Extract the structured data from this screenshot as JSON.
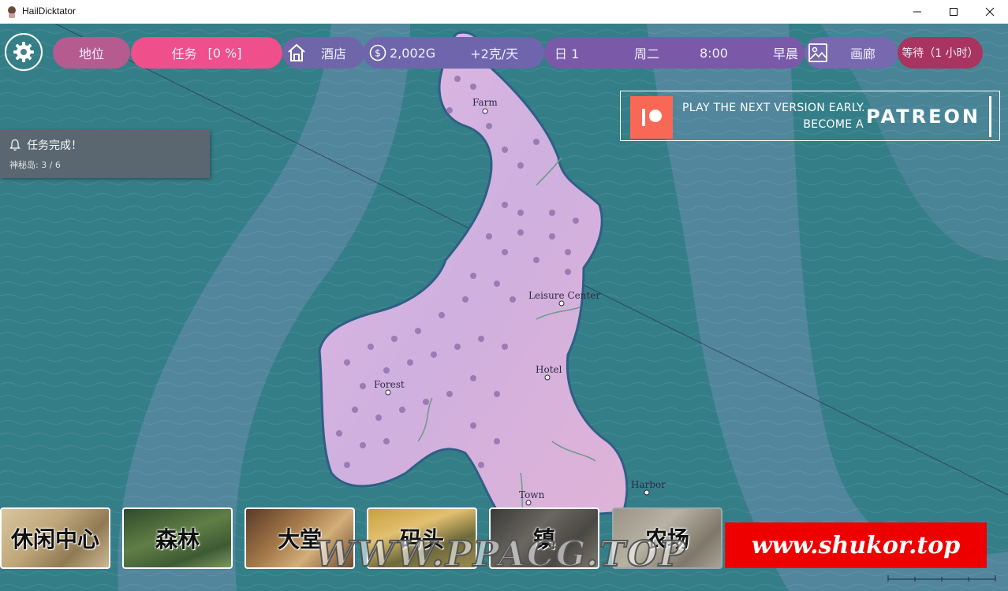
{
  "window": {
    "title": "HailDicktator"
  },
  "hud": {
    "status_label": "地位",
    "quest_label": "任务",
    "quest_progress": "[0 %]",
    "location_label": "酒店",
    "gold": "2,002G",
    "income": "+2克/天",
    "day": "日 1",
    "weekday": "周二",
    "time": "8:00",
    "period": "早晨",
    "gallery_label": "画廊",
    "wait_label": "等待（1 小时）"
  },
  "notification": {
    "title": "任务完成！",
    "detail": "神秘岛: 3 / 6"
  },
  "patreon": {
    "line1": "PLAY THE NEXT VERSION EARLY.",
    "line2": "BECOME A",
    "brand": "PATREON"
  },
  "map": {
    "labels": [
      "Farm",
      "Leisure Center",
      "Hotel",
      "Forest",
      "Harbor",
      "Town"
    ]
  },
  "locations": [
    "休闲中心",
    "森林",
    "大堂",
    "码头",
    "镇",
    "农场"
  ],
  "watermarks": {
    "ppacg": "WWW.PPACG.TOP",
    "shukor": "www.shukor.top"
  },
  "colors": {
    "quest_pill": "#ef4f8a",
    "status_pill": "#b55b8f",
    "hud_purple": "#7a5aa8",
    "wait_pill": "#a8345f",
    "island": "#d9b4de"
  }
}
